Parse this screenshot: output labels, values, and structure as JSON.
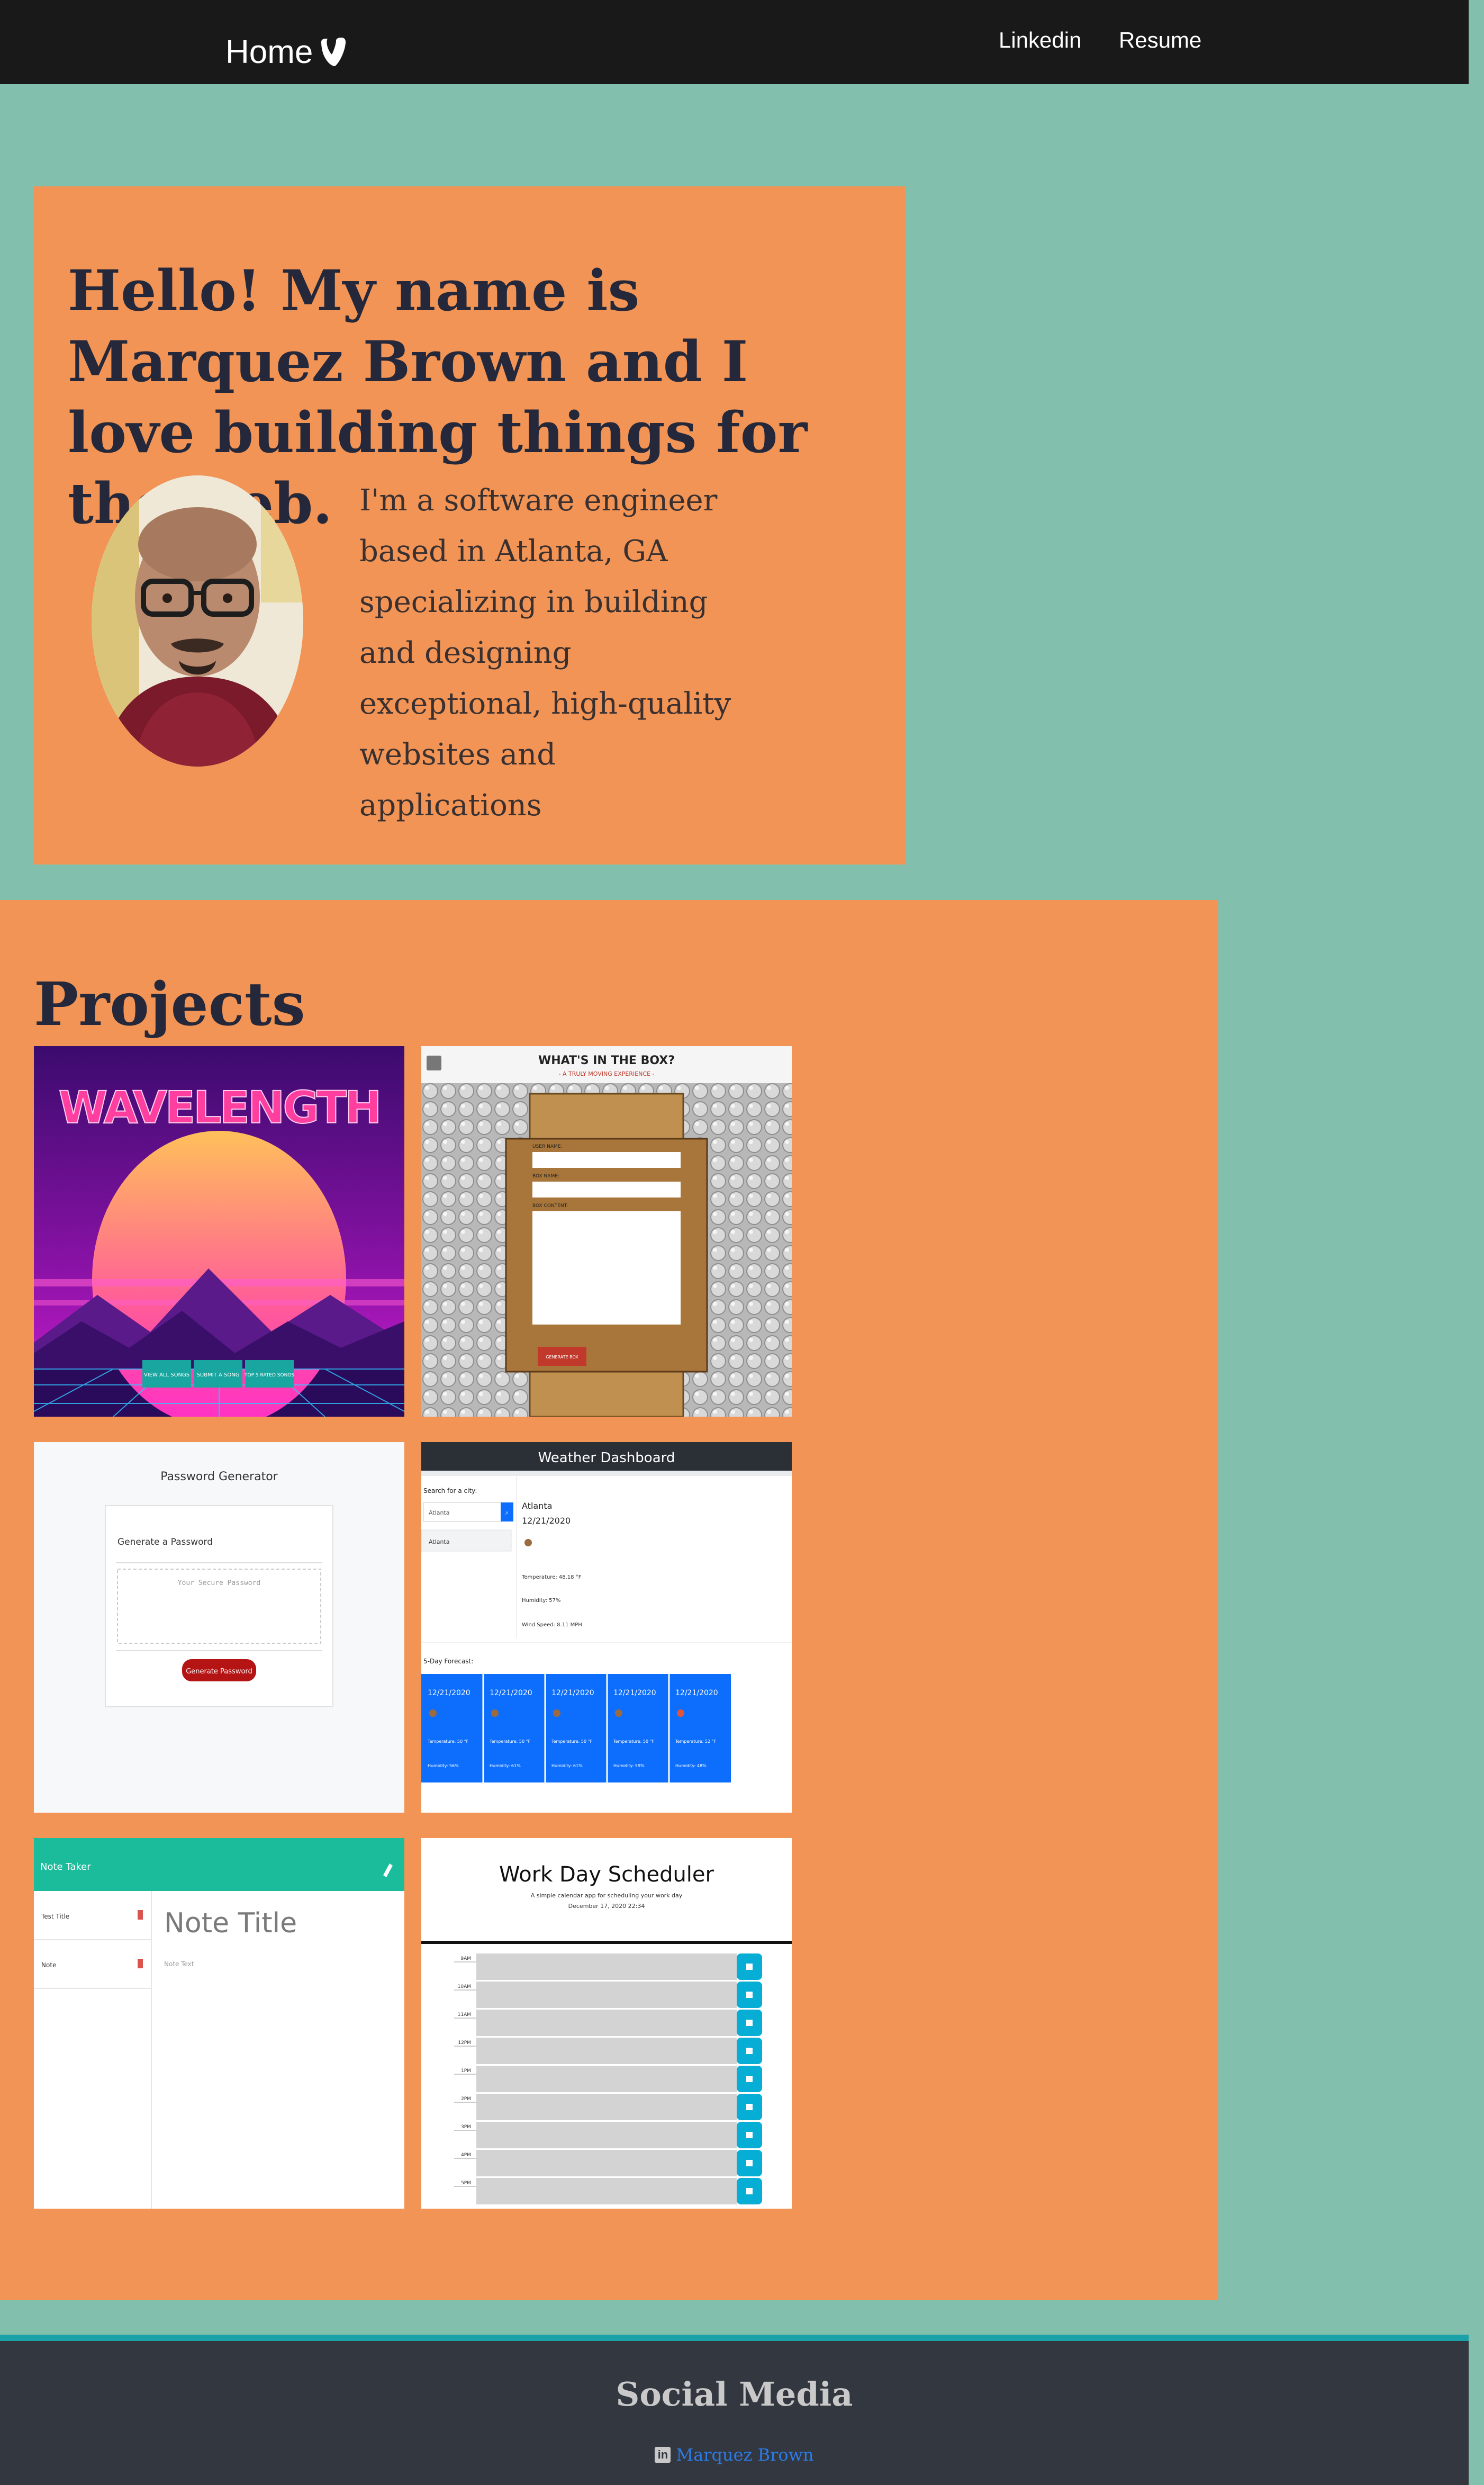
{
  "navbar": {
    "brand_label": "Home",
    "brand_icon": "typo3-logo-icon",
    "links": [
      "Linkedin",
      "Resume"
    ]
  },
  "hero": {
    "title": "Hello! My name is Marquez Brown and I love building things for the web.",
    "bio": "I'm a software engineer based in Atlanta, GA specializing in building and designing exceptional, high-quality websites and applications"
  },
  "projects": {
    "title": "Projects",
    "cards": [
      {
        "id": "wavelength",
        "logo_text": "WAVELENGTH",
        "buttons": [
          "VIEW ALL SONGS",
          "SUBMIT A SONG",
          "TOP 5 RATED SONGS"
        ]
      },
      {
        "id": "whats-in-the-box",
        "title": "WHAT'S IN THE BOX?",
        "subtitle": "- A TRULY MOVING EXPERIENCE -",
        "fields": [
          "USER NAME:",
          "BOX NAME:",
          "BOX CONTENT:"
        ],
        "button": "GENERATE BOX"
      },
      {
        "id": "password-generator",
        "title": "Password Generator",
        "card_title": "Generate a Password",
        "placeholder": "Your Secure Password",
        "button": "Generate Password"
      },
      {
        "id": "weather-dashboard",
        "title": "Weather Dashboard",
        "search_label": "Search for a city:",
        "search_value": "Atlanta",
        "history": [
          "Atlanta"
        ],
        "city": "Atlanta",
        "date": "12/21/2020",
        "temperature": "Temperature: 48.18 °F",
        "humidity": "Humidity: 57%",
        "wind": "Wind Speed: 8.11 MPH",
        "forecast_label": "5-Day Forecast:",
        "forecast": [
          {
            "date": "12/21/2020",
            "temp": "Temperature: 50 °F",
            "humidity": "Humidity: 56%"
          },
          {
            "date": "12/21/2020",
            "temp": "Temperature: 50 °F",
            "humidity": "Humidity: 61%"
          },
          {
            "date": "12/21/2020",
            "temp": "Temperature: 50 °F",
            "humidity": "Humidity: 61%"
          },
          {
            "date": "12/21/2020",
            "temp": "Temperature: 50 °F",
            "humidity": "Humidity: 59%"
          },
          {
            "date": "12/21/2020",
            "temp": "Temperature: 52 °F",
            "humidity": "Humidity: 48%"
          }
        ]
      },
      {
        "id": "note-taker",
        "header": "Note Taker",
        "notes": [
          "Test Title",
          "Note"
        ],
        "note_title": "Note Title",
        "note_text": "Note Text"
      },
      {
        "id": "work-day-scheduler",
        "title": "Work Day Scheduler",
        "subtitle": "A simple calendar app for scheduling your work day",
        "date": "December 17, 2020 22:34",
        "hours": [
          "9AM",
          "10AM",
          "11AM",
          "12PM",
          "1PM",
          "2PM",
          "3PM",
          "4PM",
          "5PM"
        ]
      }
    ]
  },
  "footer": {
    "title": "Social Media",
    "link_label": "Marquez Brown",
    "link_icon": "linkedin-icon"
  },
  "colors": {
    "page_bg": "#82c0ad",
    "panel_bg": "#f19455",
    "navbar_bg": "#191919",
    "heading": "#25283a",
    "footer_bg": "#333740",
    "footer_border": "#1ba1a8",
    "link": "#2c7be5"
  }
}
